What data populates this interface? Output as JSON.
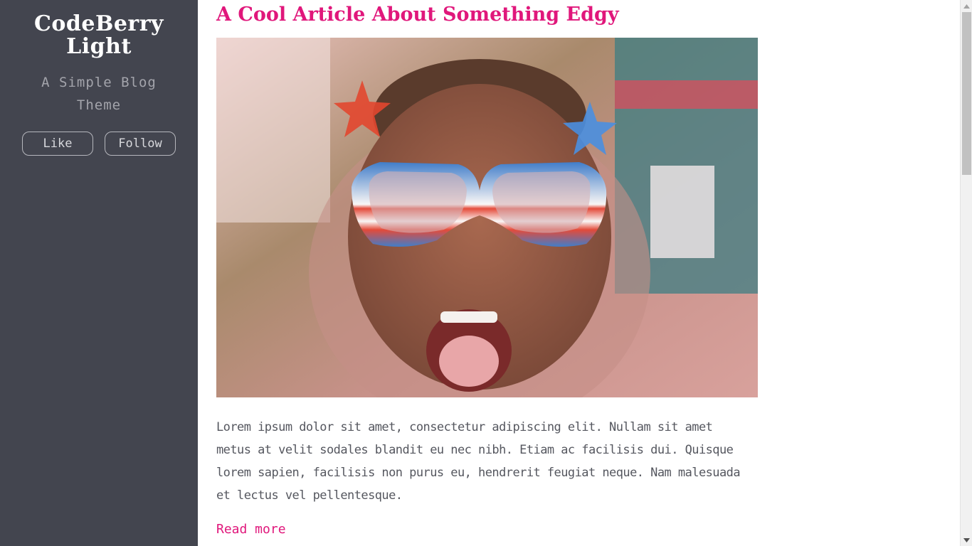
{
  "sidebar": {
    "site_title_line1": "CodeBerry",
    "site_title_line2": "Light",
    "description_line1": "A Simple Blog",
    "description_line2": "Theme",
    "like_label": "Like",
    "follow_label": "Follow",
    "background_color": "#43454f"
  },
  "post": {
    "title": "A Cool Article About Something Edgy",
    "excerpt": "Lorem ipsum dolor sit amet, consectetur adipiscing elit. Nullam sit amet metus at velit sodales blandit eu nec nibh. Etiam ac facilisis dui. Quisque lorem sapien, facilisis non purus eu, hendrerit feugiat neque. Nam malesuada et lectus vel pellentesque.",
    "read_more_label": "Read more",
    "accent_color": "#e0177b"
  },
  "icons": {
    "scroll_up": "scroll-up-arrow-icon",
    "scroll_down": "scroll-down-arrow-icon"
  }
}
